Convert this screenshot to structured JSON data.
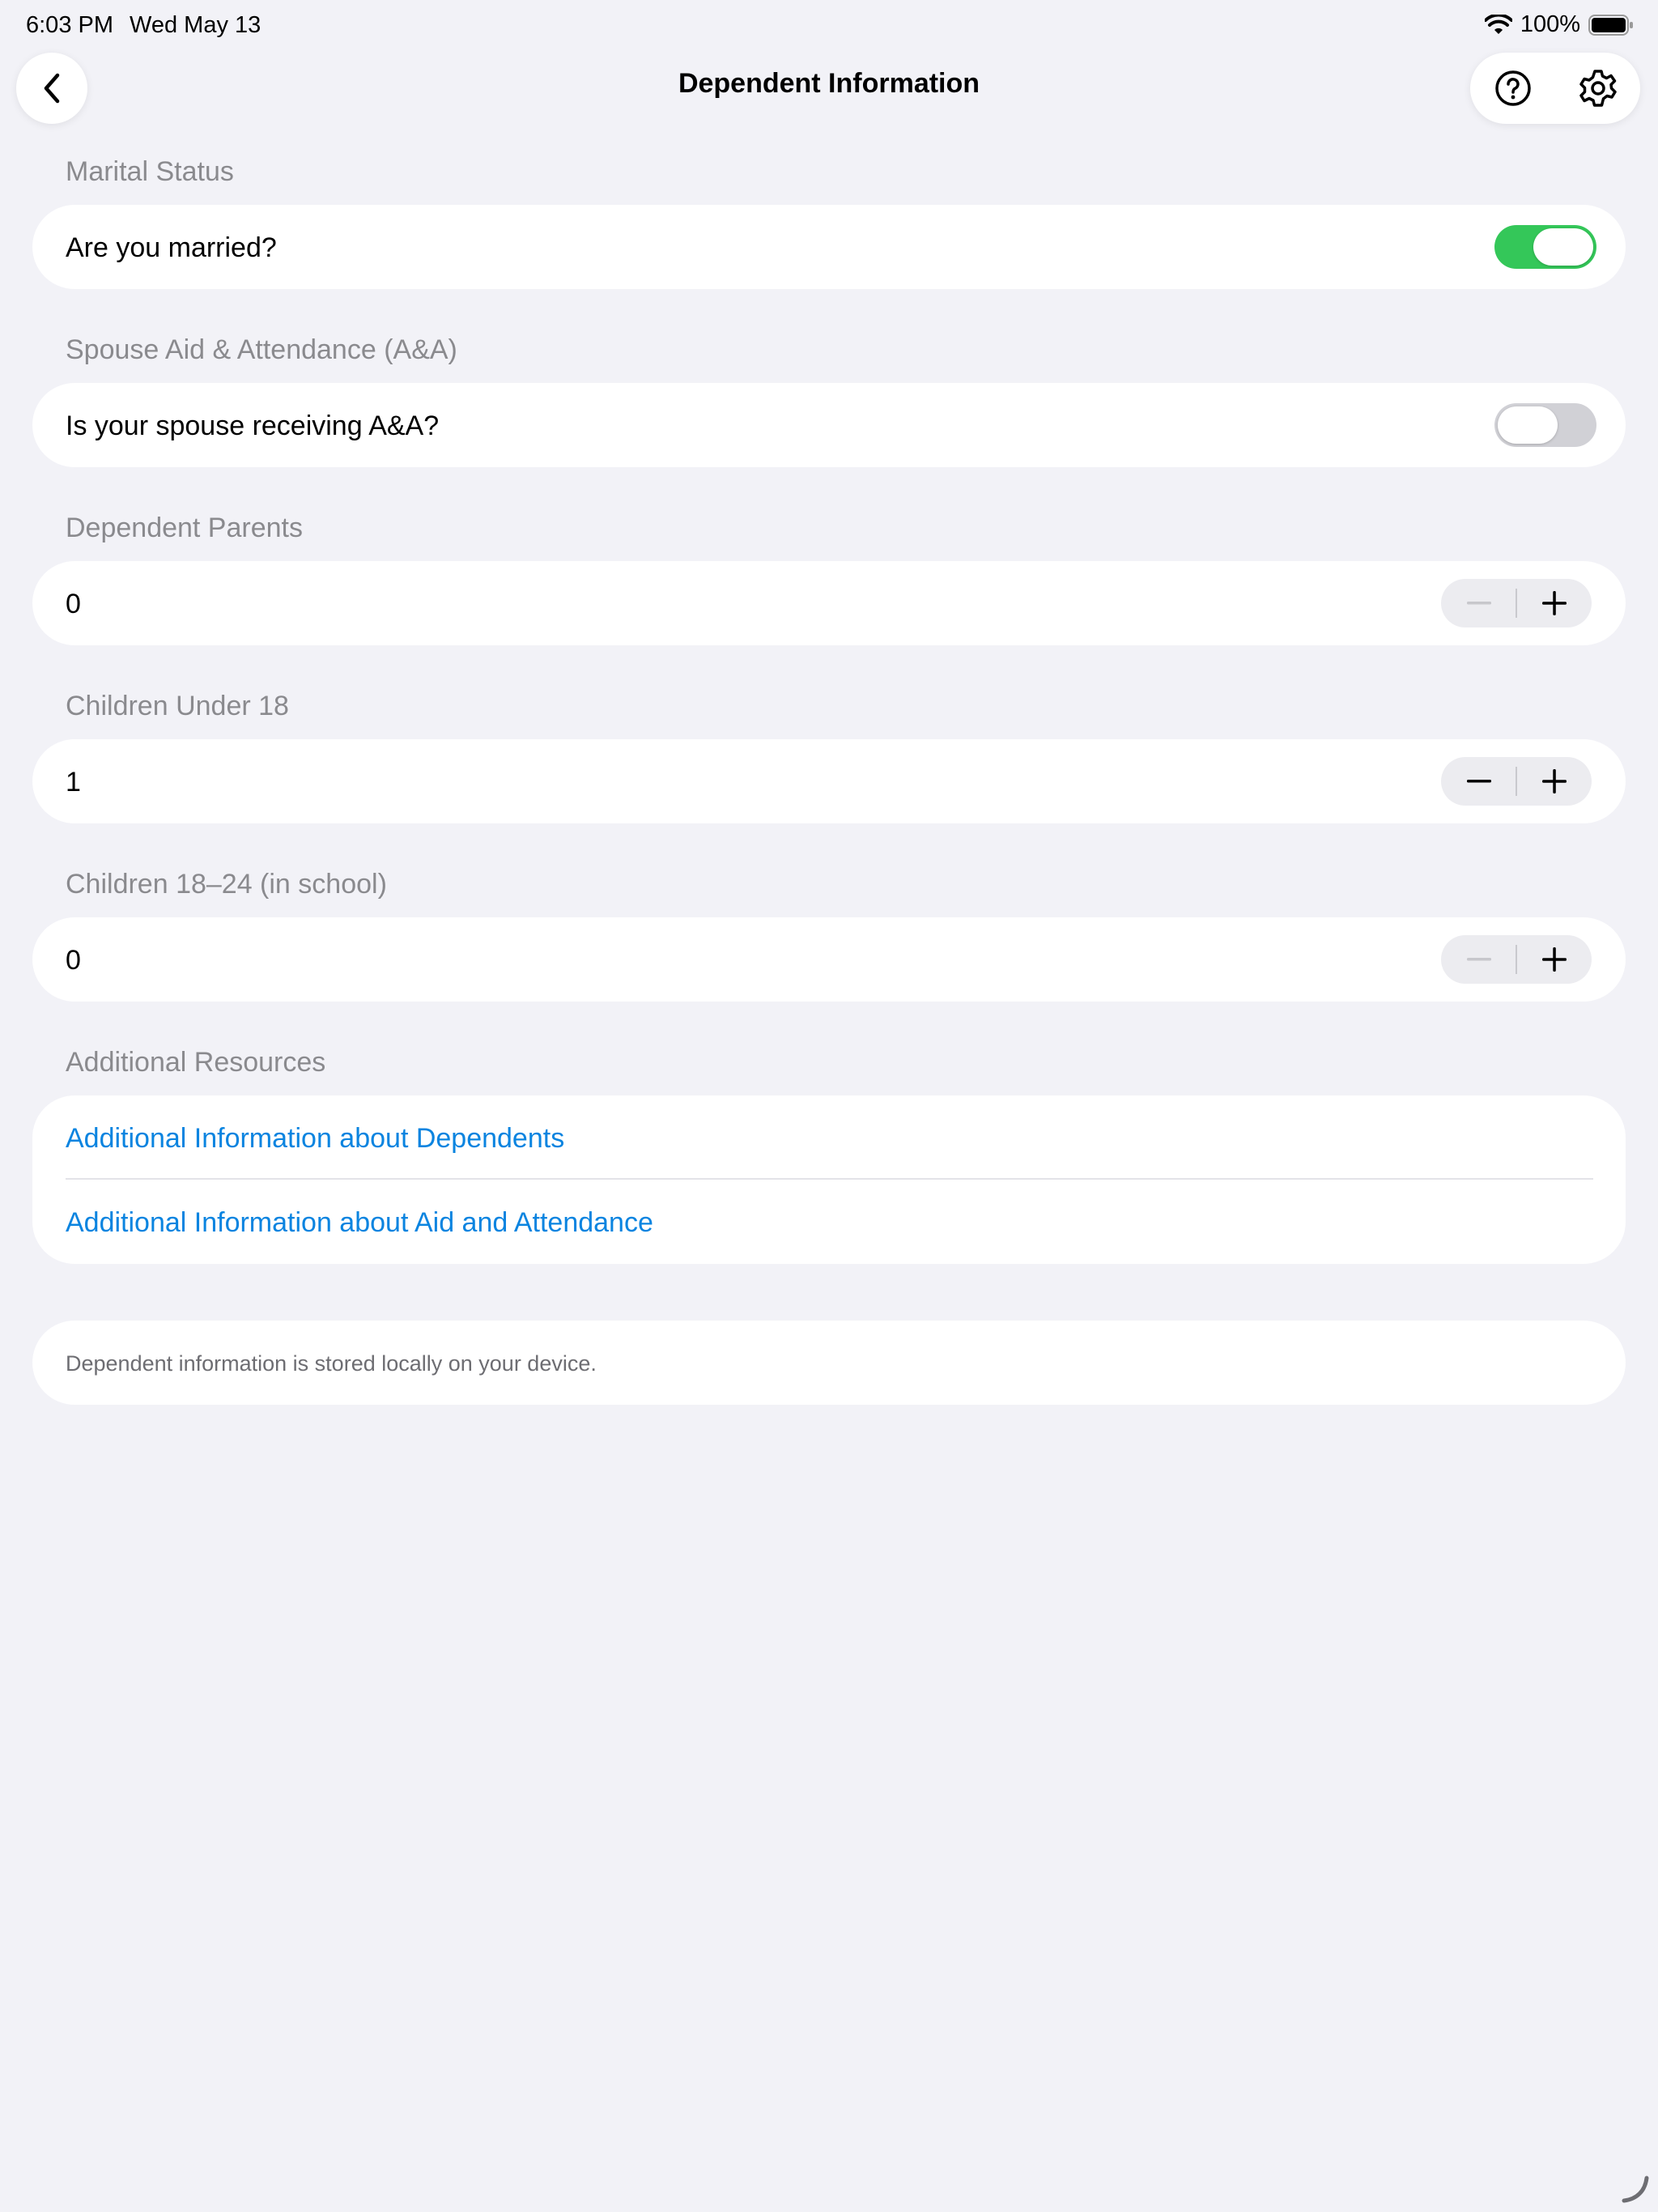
{
  "status_bar": {
    "time": "6:03 PM",
    "date": "Wed May 13",
    "battery": "100%"
  },
  "nav": {
    "title": "Dependent Information"
  },
  "sections": {
    "marital": {
      "header": "Marital Status",
      "question": "Are you married?",
      "toggle_on": true
    },
    "spouse_aa": {
      "header": "Spouse Aid & Attendance (A&A)",
      "question": "Is your spouse receiving A&A?",
      "toggle_on": false
    },
    "parents": {
      "header": "Dependent Parents",
      "value": "0"
    },
    "children_under_18": {
      "header": "Children Under 18",
      "value": "1"
    },
    "children_18_24": {
      "header": "Children 18–24 (in school)",
      "value": "0"
    },
    "resources": {
      "header": "Additional Resources",
      "links": [
        "Additional Information about Dependents",
        "Additional Information about Aid and Attendance"
      ]
    }
  },
  "footnote": "Dependent information is stored locally on your device.",
  "colors": {
    "accent": "#0a84e0",
    "toggle_on": "#34c759",
    "toggle_off": "#d1d1d6",
    "background": "#f2f2f7"
  }
}
